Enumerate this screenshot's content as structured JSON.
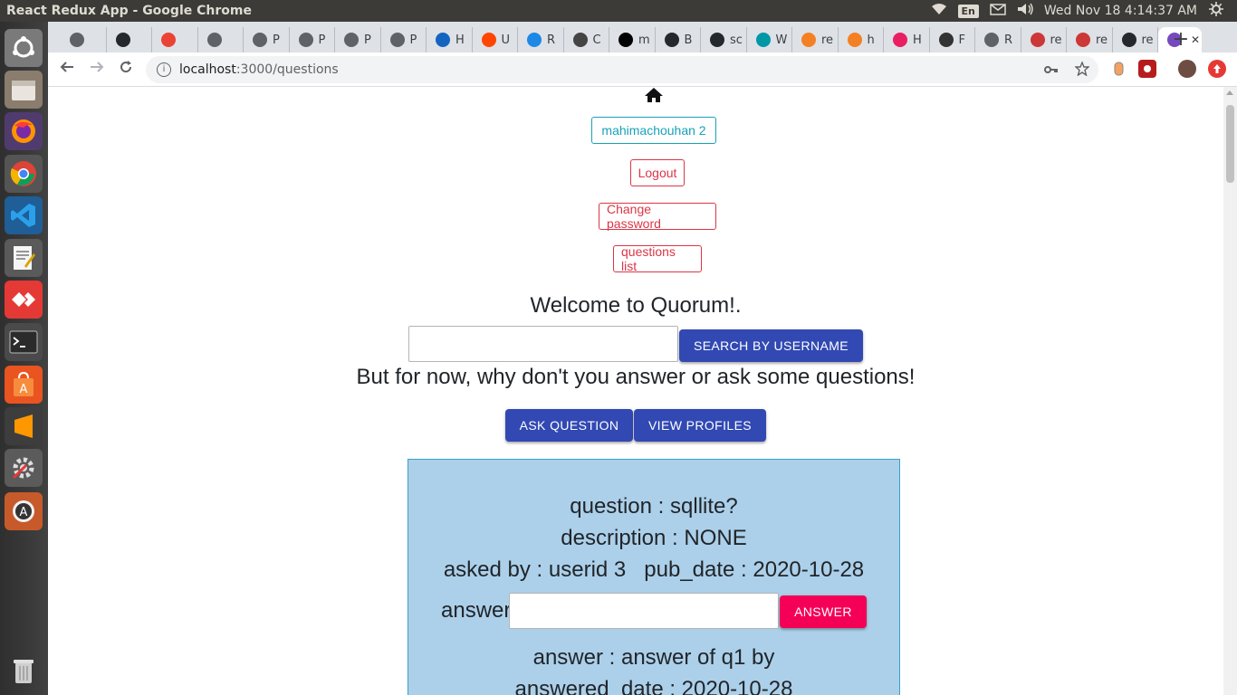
{
  "system": {
    "window_title": "React Redux App - Google Chrome",
    "keyboard": "En",
    "datetime": "Wed Nov 18  4:14:37 AM"
  },
  "launcher": {
    "icons": [
      "ubuntu-dash-icon",
      "files-icon",
      "firefox-icon",
      "chrome-icon",
      "vscode-icon",
      "text-editor-icon",
      "anydesk-icon",
      "terminal-icon",
      "software-center-icon",
      "sublime-text-icon",
      "system-settings-icon",
      "software-updater-icon",
      "trash-icon"
    ]
  },
  "browser": {
    "tabs": [
      {
        "label": "",
        "icon": "globe-icon"
      },
      {
        "label": "",
        "icon": "github-icon"
      },
      {
        "label": "",
        "icon": "gmail-icon"
      },
      {
        "label": "",
        "icon": "globe-icon"
      },
      {
        "label": "P",
        "icon": "globe-icon"
      },
      {
        "label": "P",
        "icon": "globe-icon"
      },
      {
        "label": "P",
        "icon": "globe-icon"
      },
      {
        "label": "P",
        "icon": "globe-icon"
      },
      {
        "label": "H",
        "icon": "monitor-icon"
      },
      {
        "label": "U",
        "icon": "reddit-icon"
      },
      {
        "label": "R",
        "icon": "material-icon"
      },
      {
        "label": "C",
        "icon": "codesandbox-icon"
      },
      {
        "label": "m",
        "icon": "medium-icon"
      },
      {
        "label": "B",
        "icon": "github-icon"
      },
      {
        "label": "sc",
        "icon": "github-icon"
      },
      {
        "label": "W",
        "icon": "w-icon"
      },
      {
        "label": "re",
        "icon": "stackoverflow-icon"
      },
      {
        "label": "h",
        "icon": "stackoverflow-icon"
      },
      {
        "label": "H",
        "icon": "play-icon"
      },
      {
        "label": "F",
        "icon": "linux-icon"
      },
      {
        "label": "R",
        "icon": "globe-icon"
      },
      {
        "label": "re",
        "icon": "npm-icon"
      },
      {
        "label": "re",
        "icon": "npm-icon"
      },
      {
        "label": "re",
        "icon": "github-icon"
      },
      {
        "label": "",
        "icon": "react-redux-icon",
        "active": true
      }
    ],
    "close_tab_symbol": "✕",
    "new_tab_symbol": "+",
    "url_host": "localhost",
    "url_path": ":3000/questions"
  },
  "page": {
    "username_button": "mahimachouhan 2",
    "logout_button": "Logout",
    "change_password_button": "Change password",
    "questions_list_button": "questions list",
    "welcome": "Welcome to Quorum!.",
    "search_input_value": "",
    "search_button": "SEARCH BY USERNAME",
    "subtitle": "But for now, why don't you answer or ask some questions!",
    "ask_button": "ASK QUESTION",
    "profiles_button": "VIEW PROFILES",
    "question_card": {
      "question": "question : sqllite?",
      "description": "description : NONE",
      "meta": "asked by : userid 3   pub_date : 2020-10-28",
      "answer_label": "answer",
      "answer_input_value": "",
      "answer_button": "ANSWER",
      "answer_text": "answer : answer of q1 by",
      "answered_date": "answered_date : 2020-10-28"
    }
  },
  "colors": {
    "info": "#17a2b8",
    "danger": "#dc3545",
    "primary": "#3249b3",
    "secondary": "#f50057",
    "card_bg": "#acd0ea"
  }
}
